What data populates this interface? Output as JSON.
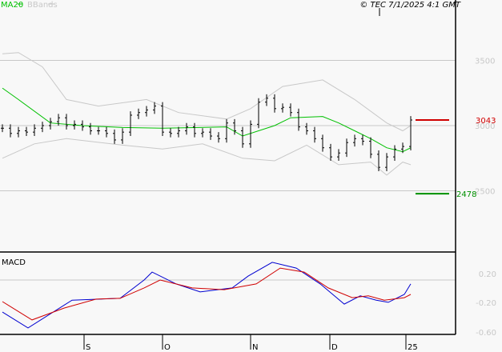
{
  "legend": {
    "ma_label": "MA20",
    "bb_label": "BBands",
    "ma_color": "#00c000",
    "bb_color": "#c8c8c8"
  },
  "copyright": "© TEC 7/1/2025 4:1 GMT",
  "chart_data": [
    {
      "type": "ohlc",
      "title": "Price",
      "ylim": [
        2050,
        3850
      ],
      "yticks": [
        {
          "v": 3500,
          "label": "3500"
        },
        {
          "v": 3000,
          "label": "3000"
        },
        {
          "v": 2500,
          "label": "2500"
        }
      ],
      "x_months": [
        {
          "label": "S",
          "idx": 10.2
        },
        {
          "label": "O",
          "idx": 20
        },
        {
          "label": "N",
          "idx": 31
        },
        {
          "label": "D",
          "idx": 40.9
        },
        {
          "label": "25",
          "idx": 50.4
        }
      ],
      "close": [
        2980,
        2940,
        2960,
        2950,
        2980,
        3000,
        3030,
        3060,
        3000,
        3010,
        2990,
        2960,
        2960,
        2940,
        2890,
        2950,
        3080,
        3100,
        3120,
        3150,
        2950,
        2940,
        2960,
        2990,
        2940,
        2950,
        2920,
        2900,
        3020,
        2960,
        2860,
        3010,
        3180,
        3210,
        3130,
        3140,
        3100,
        2990,
        2960,
        2900,
        2830,
        2760,
        2790,
        2870,
        2900,
        2880,
        2780,
        2680,
        2760,
        2820,
        2840,
        3043
      ],
      "ma20": [
        [
          0,
          3288
        ],
        [
          2,
          3200
        ],
        [
          6,
          3020
        ],
        [
          10,
          3000
        ],
        [
          15,
          2985
        ],
        [
          20,
          2980
        ],
        [
          28,
          2990
        ],
        [
          30,
          2920
        ],
        [
          34,
          3000
        ],
        [
          36,
          3060
        ],
        [
          40,
          3070
        ],
        [
          42,
          3020
        ],
        [
          44,
          2960
        ],
        [
          46,
          2900
        ],
        [
          48,
          2830
        ],
        [
          50,
          2800
        ],
        [
          51,
          2830
        ]
      ],
      "bb_upper": [
        [
          0,
          3550
        ],
        [
          2,
          3560
        ],
        [
          5,
          3450
        ],
        [
          8,
          3200
        ],
        [
          12,
          3150
        ],
        [
          18,
          3200
        ],
        [
          22,
          3100
        ],
        [
          28,
          3050
        ],
        [
          31,
          3130
        ],
        [
          35,
          3300
        ],
        [
          40,
          3350
        ],
        [
          44,
          3200
        ],
        [
          48,
          3020
        ],
        [
          50,
          2960
        ],
        [
          51,
          3000
        ]
      ],
      "bb_lower": [
        [
          0,
          2750
        ],
        [
          4,
          2860
        ],
        [
          8,
          2900
        ],
        [
          15,
          2850
        ],
        [
          20,
          2820
        ],
        [
          25,
          2860
        ],
        [
          30,
          2750
        ],
        [
          34,
          2730
        ],
        [
          38,
          2850
        ],
        [
          42,
          2700
        ],
        [
          46,
          2720
        ],
        [
          48,
          2620
        ],
        [
          50,
          2720
        ],
        [
          51,
          2700
        ]
      ],
      "resistance": {
        "value": 3043,
        "label": "3043",
        "color": "#d00000"
      },
      "support": {
        "value": 2478,
        "label": "2478",
        "color": "#009000"
      }
    },
    {
      "type": "line",
      "title": "MACD",
      "yticks": [
        {
          "v": 0.2,
          "label": "0.20"
        },
        {
          "v": -0.2,
          "label": "-0.20"
        },
        {
          "v": -0.6,
          "label": "-0.60"
        }
      ],
      "series": [
        {
          "name": "MACD",
          "color": "#0000d0",
          "points": [
            [
              0,
              -0.69
            ],
            [
              3.2,
              -1.13
            ],
            [
              8.7,
              -0.36
            ],
            [
              14.7,
              -0.31
            ],
            [
              17.7,
              0.2
            ],
            [
              18.7,
              0.42
            ],
            [
              21.7,
              0.09
            ],
            [
              24.7,
              -0.13
            ],
            [
              28.7,
              -0.02
            ],
            [
              30.7,
              0.31
            ],
            [
              33.7,
              0.69
            ],
            [
              36.7,
              0.53
            ],
            [
              39.7,
              0.09
            ],
            [
              42.7,
              -0.47
            ],
            [
              44.7,
              -0.24
            ],
            [
              46.7,
              -0.36
            ],
            [
              48.2,
              -0.42
            ],
            [
              50.2,
              -0.2
            ],
            [
              51,
              0.09
            ]
          ]
        },
        {
          "name": "Signal",
          "color": "#d00000",
          "points": [
            [
              0,
              -0.4
            ],
            [
              3.7,
              -0.91
            ],
            [
              7.7,
              -0.58
            ],
            [
              11.7,
              -0.33
            ],
            [
              14.7,
              -0.31
            ],
            [
              17.7,
              -0.02
            ],
            [
              19.7,
              0.2
            ],
            [
              23.7,
              -0.02
            ],
            [
              27.7,
              -0.07
            ],
            [
              31.7,
              0.09
            ],
            [
              34.7,
              0.53
            ],
            [
              37.7,
              0.42
            ],
            [
              40.7,
              -0.02
            ],
            [
              43.7,
              -0.29
            ],
            [
              45.7,
              -0.24
            ],
            [
              47.7,
              -0.36
            ],
            [
              50.2,
              -0.29
            ],
            [
              51,
              -0.2
            ]
          ]
        }
      ]
    }
  ]
}
